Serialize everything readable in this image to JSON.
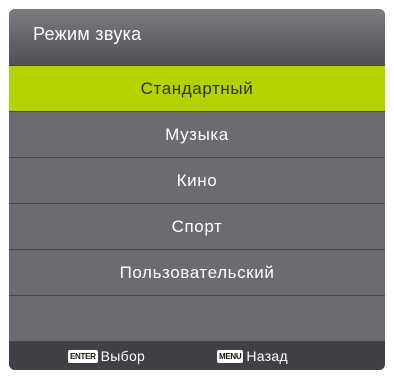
{
  "header": {
    "title": "Режим звука"
  },
  "menu": {
    "items": [
      {
        "label": "Стандартный",
        "selected": true
      },
      {
        "label": "Музыка",
        "selected": false
      },
      {
        "label": "Кино",
        "selected": false
      },
      {
        "label": "Спорт",
        "selected": false
      },
      {
        "label": "Пользовательский",
        "selected": false
      }
    ]
  },
  "footer": {
    "enter_key": "ENTER",
    "enter_label": "Выбор",
    "menu_key": "MENU",
    "menu_label": "Назад"
  },
  "colors": {
    "selected_background": "#b4d200",
    "item_background": "#6a6c71"
  }
}
